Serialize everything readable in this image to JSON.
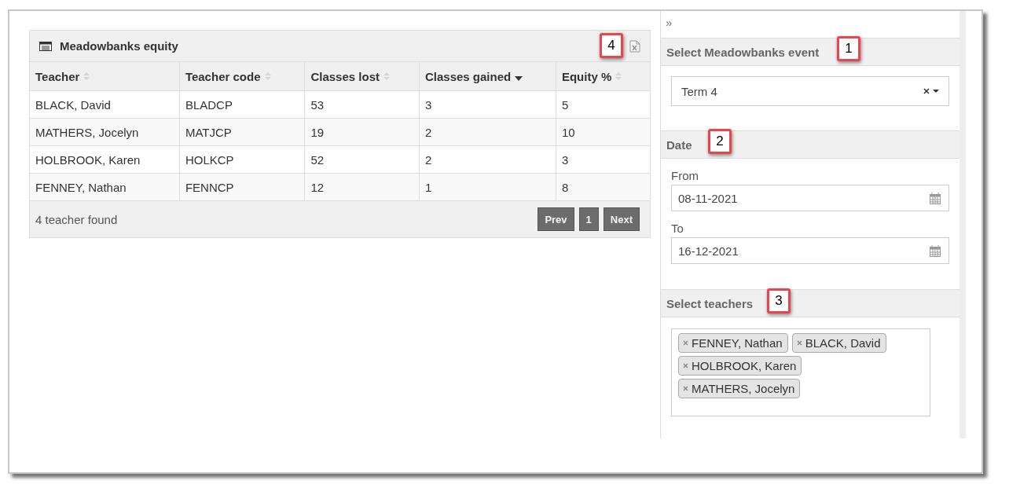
{
  "table_card": {
    "title": "Meadowbanks equity",
    "callout": "4",
    "columns": [
      {
        "label": "Teacher",
        "sorted": false
      },
      {
        "label": "Teacher code",
        "sorted": false
      },
      {
        "label": "Classes lost",
        "sorted": false
      },
      {
        "label": "Classes gained",
        "sorted": true
      },
      {
        "label": "Equity %",
        "sorted": false
      }
    ],
    "rows": [
      [
        "BLACK, David",
        "BLADCP",
        "53",
        "3",
        "5"
      ],
      [
        "MATHERS, Jocelyn",
        "MATJCP",
        "19",
        "2",
        "10"
      ],
      [
        "HOLBROOK, Karen",
        "HOLKCP",
        "52",
        "2",
        "3"
      ],
      [
        "FENNEY, Nathan",
        "FENNCP",
        "12",
        "1",
        "8"
      ]
    ],
    "footer": "4 teacher found",
    "pagination": [
      "Prev",
      "1",
      "Next"
    ]
  },
  "filter_panel": {
    "collapse": "»",
    "event": {
      "title": "Select Meadowbanks event",
      "callout": "1",
      "value": "Term 4"
    },
    "date": {
      "title": "Date",
      "callout": "2",
      "from_label": "From",
      "from": "08-11-2021",
      "to_label": "To",
      "to": "16-12-2021"
    },
    "teachers": {
      "title": "Select teachers",
      "callout": "3",
      "selected": [
        "FENNEY, Nathan",
        "BLACK, David",
        "HOLBROOK, Karen",
        "MATHERS, Jocelyn"
      ]
    }
  }
}
